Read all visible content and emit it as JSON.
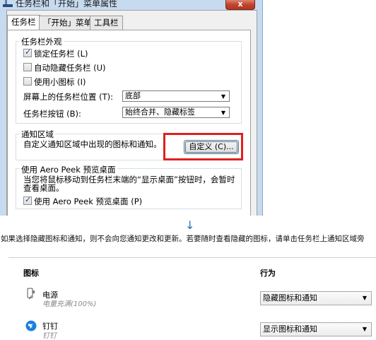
{
  "window": {
    "title": "任务栏和「开始」菜单属性",
    "close": "x"
  },
  "tabs": [
    {
      "label": "任务栏"
    },
    {
      "label": "「开始」菜单"
    },
    {
      "label": "工具栏"
    }
  ],
  "appearance": {
    "legend": "任务栏外观",
    "lock_label": "锁定任务栏 (L)",
    "autohide_label": "自动隐藏任务栏 (U)",
    "small_icons_label": "使用小图标 (I)",
    "position_label": "屏幕上的任务栏位置 (T):",
    "position_value": "底部",
    "buttons_label": "任务栏按钮 (B):",
    "buttons_value": "始终合并、隐藏标签"
  },
  "notify": {
    "legend": "通知区域",
    "text": "自定义通知区域中出现的图标和通知。",
    "customize_button": "自定义 (C)..."
  },
  "peek": {
    "legend": "使用 Aero Peek 预览桌面",
    "text_line1": "当您将鼠标移动到任务栏末端的“显示桌面”按钮时，会暂时",
    "text_line2": "查看桌面。",
    "checkbox_label": "使用 Aero Peek 预览桌面 (P)"
  },
  "arrow_glyph": "↓",
  "lower": {
    "info": "如果选择隐藏图标和通知，则不会向您通知更改和更新。若要随时查看隐藏的图标，请单击任务栏上通知区域旁",
    "col_icon": "图标",
    "col_behavior": "行为",
    "rows": [
      {
        "name": "电源",
        "sub": "电量充满(100%)",
        "behavior": "隐藏图标和通知",
        "icon": "power-icon"
      },
      {
        "name": "钉钉",
        "sub": "钉钉",
        "behavior": "显示图标和通知",
        "icon": "dingtalk-icon"
      }
    ]
  },
  "colors": {
    "highlight": "#e0201f",
    "close": "#c2422b",
    "arrow": "#2a6fb8"
  }
}
